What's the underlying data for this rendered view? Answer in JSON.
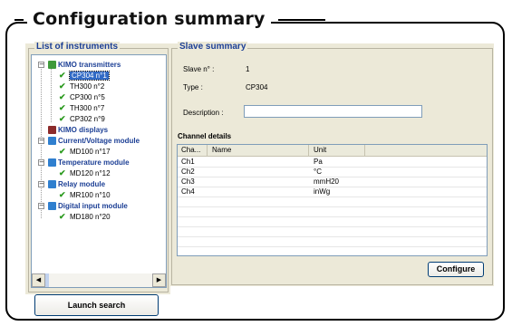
{
  "window": {
    "title": "Configuration summary"
  },
  "instruments": {
    "legend": "List of instruments",
    "groups": [
      {
        "label": "KIMO transmitters",
        "children": [
          "CP304 n°1",
          "TH300 n°2",
          "CP300 n°5",
          "TH300 n°7",
          "CP302 n°9"
        ]
      },
      {
        "label": "KIMO displays",
        "children": []
      },
      {
        "label": "Current/Voltage module",
        "children": [
          "MD100 n°17"
        ]
      },
      {
        "label": "Temperature module",
        "children": [
          "MD120 n°12"
        ]
      },
      {
        "label": "Relay module",
        "children": [
          "MR100 n°10"
        ]
      },
      {
        "label": "Digital input module",
        "children": [
          "MD180 n°20"
        ]
      }
    ],
    "selected": "CP304 n°1"
  },
  "launch_button": "Launch search",
  "slave": {
    "legend": "Slave summary",
    "slave_no_label": "Slave n° :",
    "slave_no_value": "1",
    "type_label": "Type :",
    "type_value": "CP304",
    "description_label": "Description :",
    "description_value": ""
  },
  "channels": {
    "title": "Channel details",
    "headers": [
      "Cha...",
      "Name",
      "Unit"
    ],
    "rows": [
      {
        "channel": "Ch1",
        "name": "",
        "unit": "Pa"
      },
      {
        "channel": "Ch2",
        "name": "",
        "unit": "°C"
      },
      {
        "channel": "Ch3",
        "name": "",
        "unit": "mmH20"
      },
      {
        "channel": "Ch4",
        "name": "",
        "unit": "inWg"
      }
    ]
  },
  "configure_button": "Configure",
  "colors": {
    "accent": "#1c3f95",
    "panel": "#ece9d8",
    "selection": "#316ac5",
    "check": "#2b9a1e"
  }
}
